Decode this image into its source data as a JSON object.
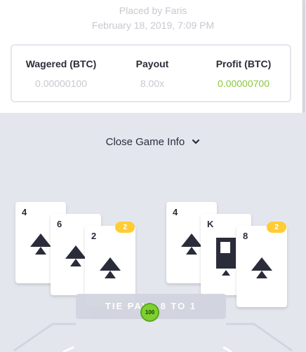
{
  "bet": {
    "placed_by": "Placed by Faris",
    "date": "February 18, 2019, 7:09 PM",
    "wagered_label": "Wagered (BTC)",
    "wagered_value": "0.00000100",
    "payout_label": "Payout",
    "payout_value": "8.00x",
    "profit_label": "Profit (BTC)",
    "profit_value": "0.00000700"
  },
  "game_info": {
    "toggle_label": "Close Game Info"
  },
  "hands": {
    "left": {
      "cards": [
        {
          "rank": "4",
          "suit": "spade"
        },
        {
          "rank": "6",
          "suit": "spade"
        },
        {
          "rank": "2",
          "suit": "spade"
        }
      ],
      "badge": "2"
    },
    "right": {
      "cards": [
        {
          "rank": "4",
          "suit": "spade"
        },
        {
          "rank": "K",
          "suit": "spade"
        },
        {
          "rank": "8",
          "suit": "spade"
        }
      ],
      "badge": "2"
    }
  },
  "table": {
    "tie_text": "TIE PAYS 8 TO 1",
    "chip_value": "100"
  },
  "colors": {
    "profit": "#8cc63f",
    "badge": "#ffcc33",
    "chip": "#7dd12f",
    "background": "#e4e6ee"
  }
}
